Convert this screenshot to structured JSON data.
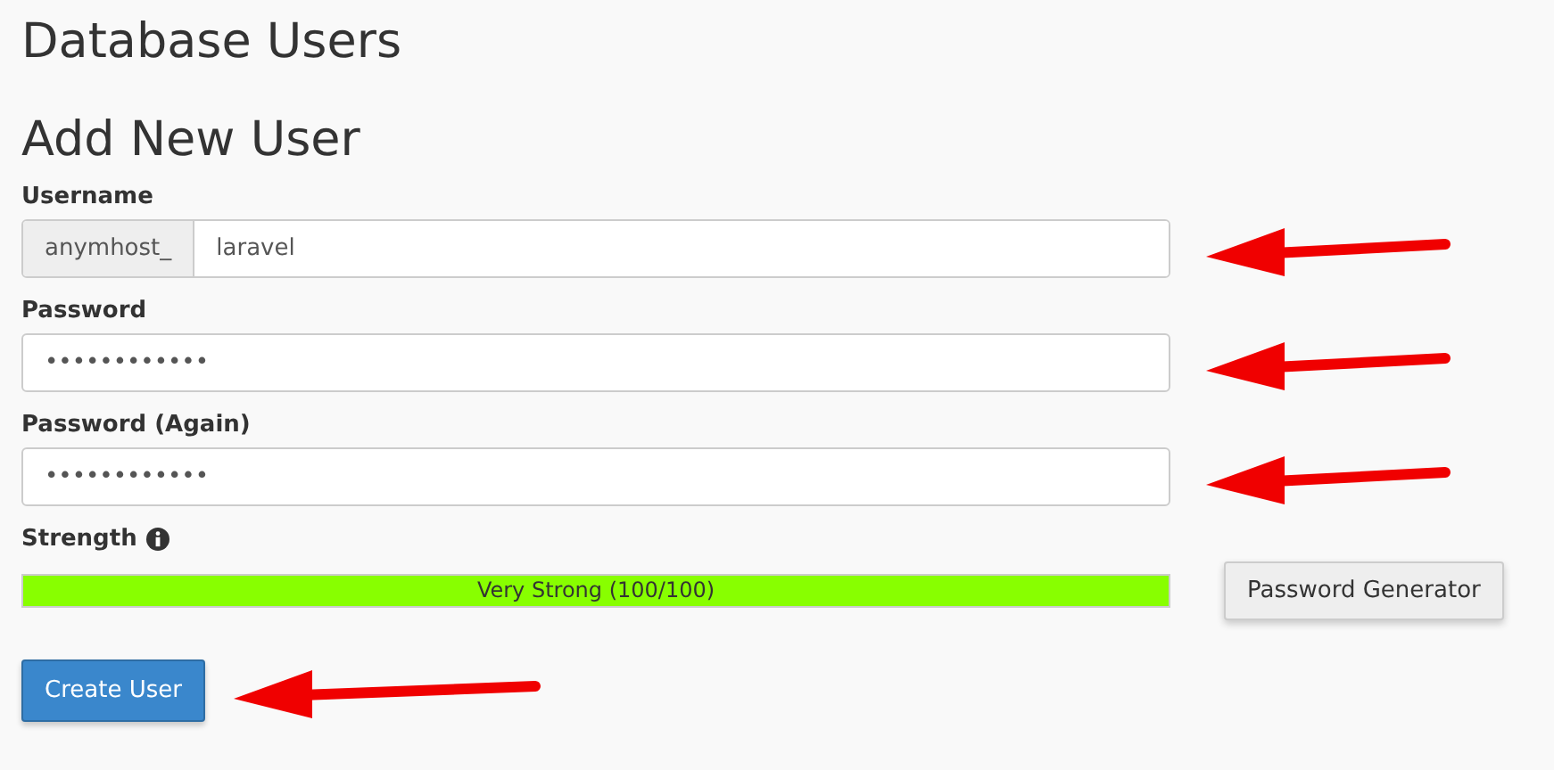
{
  "page_title": "Database Users",
  "form": {
    "title": "Add New User",
    "fields": [
      {
        "kind": "prefixed",
        "label": "Username",
        "prefix": "anymhost_",
        "value": "laravel",
        "pointed_at": true
      },
      {
        "kind": "plain",
        "label": "Password",
        "value": "••••••••••••",
        "pointed_at": true
      },
      {
        "kind": "plain",
        "label": "Password (Again)",
        "value": "••••••••••••",
        "pointed_at": true
      }
    ],
    "strength": {
      "label": "Strength",
      "level": 1,
      "reading": "Very Strong (100/100)"
    },
    "generator_button": "Password Generator",
    "submit_button": {
      "label": "Create User",
      "pointed_at": true
    }
  }
}
